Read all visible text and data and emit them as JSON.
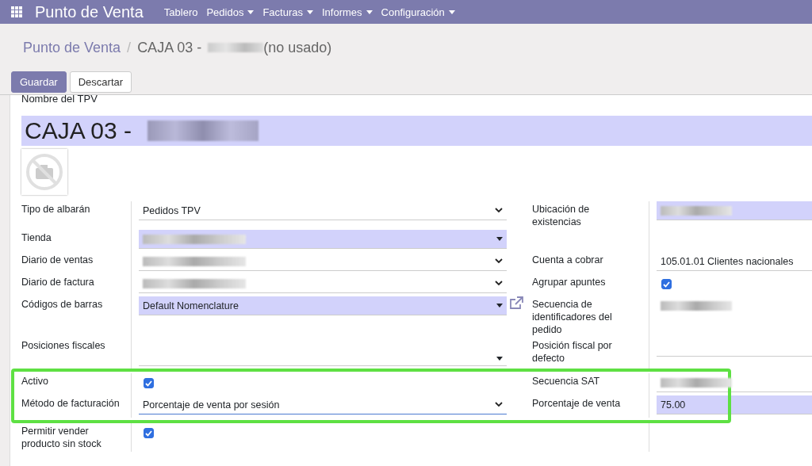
{
  "navbar": {
    "app_title": "Punto de Venta",
    "menus": [
      {
        "label": "Tablero",
        "dropdown": false
      },
      {
        "label": "Pedidos",
        "dropdown": true
      },
      {
        "label": "Facturas",
        "dropdown": true
      },
      {
        "label": "Informes",
        "dropdown": true
      },
      {
        "label": "Configuración",
        "dropdown": true
      }
    ]
  },
  "breadcrumb": {
    "parent": "Punto de Venta",
    "separator": "/",
    "current": "CAJA 03 -",
    "redacted": true,
    "suffix": "(no usado)"
  },
  "buttons": [
    {
      "label": "Guardar",
      "kind": "primary"
    },
    {
      "label": "Descartar",
      "kind": "secondary"
    }
  ],
  "form": {
    "name_label": "Nombre del TPV",
    "name_value": "CAJA 03 -",
    "name_redacted": true,
    "name_required": true,
    "rows": [
      {
        "highlighted": false,
        "left": {
          "label": "Tipo de albarán",
          "kind": "select",
          "value": "Pedidos TPV",
          "required": false
        },
        "right": {
          "label": "Ubicación de existencias",
          "kind": "input",
          "redacted": true,
          "required": true
        }
      },
      {
        "highlighted": false,
        "left": {
          "label": "Tienda",
          "kind": "select",
          "redacted": true,
          "required": true
        }
      },
      {
        "highlighted": false,
        "left": {
          "label": "Diario de ventas",
          "kind": "select",
          "redacted": true,
          "required": false
        },
        "right": {
          "label": "Cuenta a cobrar",
          "kind": "input",
          "value": "105.01.01 Clientes nacionales",
          "required": false
        }
      },
      {
        "highlighted": false,
        "left": {
          "label": "Diario de factura",
          "kind": "select",
          "redacted": true,
          "required": false
        },
        "right": {
          "label": "Agrupar apuntes",
          "kind": "checkbox",
          "checked": true
        }
      },
      {
        "highlighted": false,
        "left": {
          "label": "Códigos de barras",
          "kind": "select",
          "value": "Default Nomenclature",
          "required": true,
          "external_link": true
        },
        "right": {
          "label": "Secuencia de identificadores del pedido",
          "kind": "readonly",
          "redacted": true
        }
      },
      {
        "highlighted": false,
        "left": {
          "label": "Posiciones fiscales",
          "kind": "select",
          "required": false
        },
        "right": {
          "label": "Posición fiscal por defecto",
          "kind": "input",
          "required": false
        }
      },
      {
        "highlighted": true,
        "left": {
          "label": "Activo",
          "kind": "checkbox",
          "checked": true
        },
        "right": {
          "label": "Secuencia SAT",
          "kind": "input",
          "redacted": true,
          "required": false
        }
      },
      {
        "highlighted": true,
        "left": {
          "label": "Método de facturación",
          "kind": "select",
          "value": "Porcentaje de venta por sesión",
          "required": false,
          "focused": true
        },
        "right": {
          "label": "Porcentaje de venta",
          "kind": "input",
          "value": "75.00",
          "required": true
        }
      },
      {
        "highlighted": false,
        "left": {
          "label": "Permitir vender producto sin stock",
          "kind": "checkbox",
          "checked": true
        }
      }
    ]
  }
}
